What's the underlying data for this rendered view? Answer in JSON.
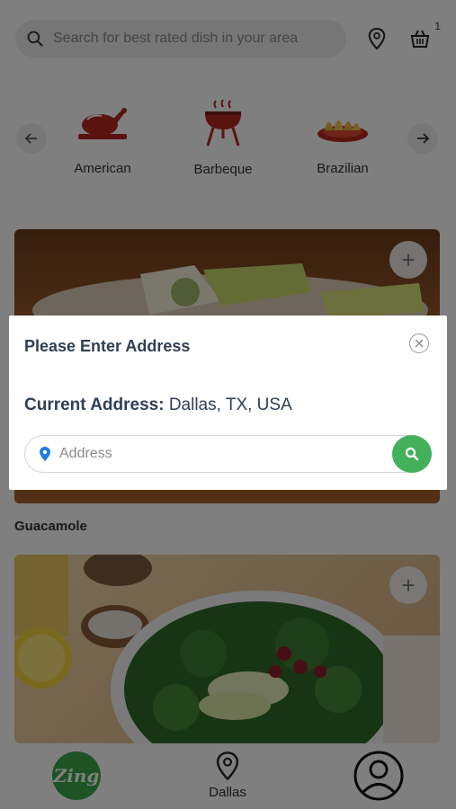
{
  "header": {
    "search_placeholder": "Search for best rated dish in your area",
    "cart_count": "1"
  },
  "categories": [
    {
      "label": "American",
      "icon": "roast-chicken-icon"
    },
    {
      "label": "Barbeque",
      "icon": "grill-icon"
    },
    {
      "label": "Brazilian",
      "icon": "pastry-plate-icon"
    }
  ],
  "dishes": [
    {
      "name": "",
      "image": "salad-dish-image"
    },
    {
      "name": "Guacamole",
      "image": "kale-salad-image"
    }
  ],
  "bottom_nav": {
    "logo_text": "Zing",
    "city": "Dallas"
  },
  "modal": {
    "title": "Please Enter Address",
    "current_address_label": "Current Address:",
    "current_address_value": "Dallas, TX, USA",
    "address_placeholder": "Address"
  },
  "colors": {
    "accent_green": "#43b05c",
    "brand_green": "#3aa64a",
    "modal_text": "#2f3f55",
    "icon_red": "#b5271e",
    "pin_blue": "#1e7be0"
  }
}
